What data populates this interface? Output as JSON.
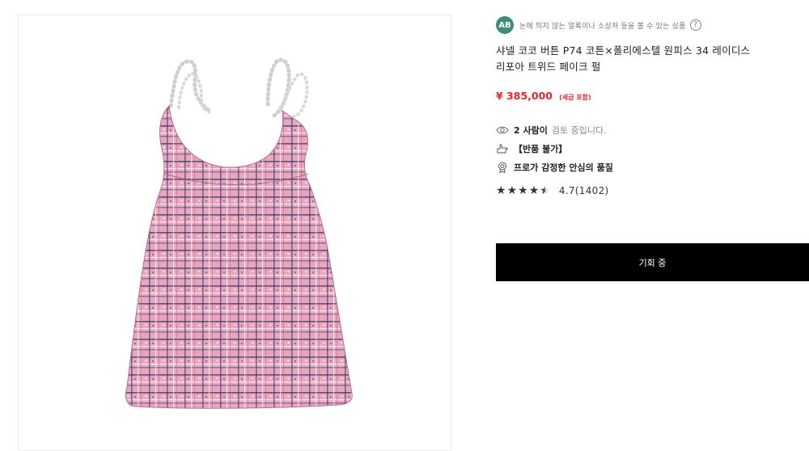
{
  "product": {
    "condition_badge": "AB",
    "condition_text": "눈에 띄지 않는 얼룩이나 소상처 등을 볼 수 있는 상품",
    "help_symbol": "?",
    "title": "샤넬 코코 버튼 P74 코튼×폴리에스텔 원피스 34 레이디스\n리포아 트위드 페이크 펄",
    "price": "¥ 385,000",
    "tax_note": "(세금 포함)",
    "viewers_count": "2 사람이",
    "viewers_suffix": "검토 중입니다.",
    "returns_text": "【반품 불가】",
    "quality_text": "프로가 감정한 안심의 품질",
    "rating_text": "4.7(1402)",
    "rating_value": 4.7,
    "rating_max": 5,
    "cta_label": "기회 중"
  },
  "icons": {
    "next": "chevron-right-icon",
    "help": "question-circle-icon",
    "viewers": "eye-icon",
    "returns": "hand-point-icon",
    "quality": "award-medal-icon",
    "star": "star-icon"
  },
  "colors": {
    "price": "#e2262f",
    "badge": "#3f8f78",
    "cta_bg": "#000000",
    "tweed_pink": "#e9a6bd",
    "tweed_navy": "#2b3566"
  }
}
